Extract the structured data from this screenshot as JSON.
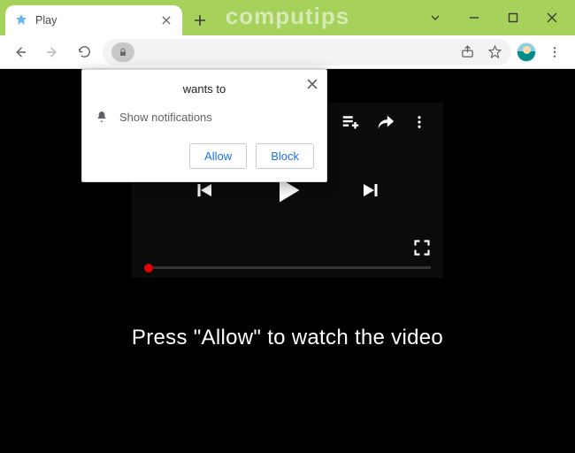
{
  "window": {
    "watermark": "computips"
  },
  "tab": {
    "title": "Play"
  },
  "permission": {
    "origin_line": "wants to",
    "notif_label": "Show notifications",
    "allow": "Allow",
    "block": "Block"
  },
  "page": {
    "caption": "Press \"Allow\" to watch the video"
  }
}
